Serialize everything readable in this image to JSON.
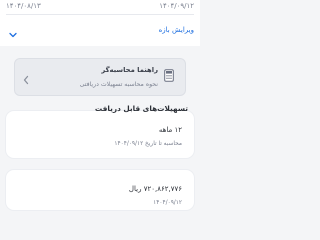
{
  "header": {
    "date_left": "۱۴۰۴/۰۸/۱۳",
    "date_right": "۱۴۰۴/۰۹/۱۲",
    "edit_range_label": "ویرایش بازه"
  },
  "guide": {
    "title": "راهنما محاسبه‌گر",
    "subtitle": "نحوه محاسبه تسهیلات دریافتی"
  },
  "section": {
    "title": "تسهیلات‌های قابل دریافت"
  },
  "items": [
    {
      "amount": "۱۲ ماهه",
      "note": "محاسبه تا تاریخ ۱۴۰۴/۰۹/۱۲"
    },
    {
      "amount": "۷۲۰,۸۶۲,۷۷۶ ریال",
      "note": "۱۴۰۴/۰۹/۱۲"
    }
  ],
  "icons": {
    "chevron": "chevron-down-icon",
    "calculator": "calculator-icon",
    "arrow": "chevron-left-icon"
  },
  "colors": {
    "accent": "#1e6fe0",
    "background": "#f4f5f7",
    "card": "#ffffff"
  }
}
